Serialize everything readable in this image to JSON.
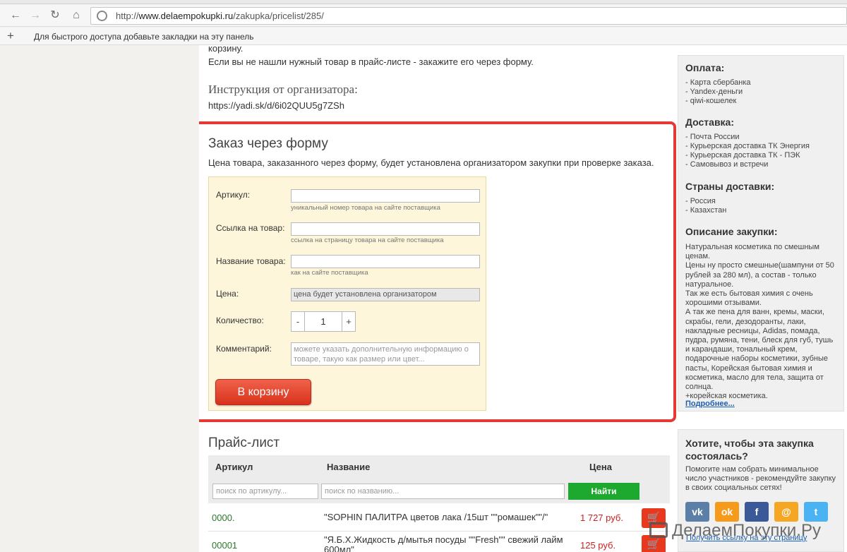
{
  "browser": {
    "url_host": "www.delaempokupki.ru",
    "url_path": "/zakupka/pricelist/285/",
    "url_prefix": "http://",
    "bookmarks_hint": "Для быстрого доступа добавьте закладки на эту панель"
  },
  "intro": {
    "cut_line": "корзину.",
    "not_found": "Если вы не нашли нужный товар в прайс-листе - закажите его через форму."
  },
  "instructions": {
    "title": "Инструкция от организатора:",
    "link": "https://yadi.sk/d/6i02QUU5g7ZSh"
  },
  "order_form": {
    "title": "Заказ через форму",
    "description": "Цена товара, заказанного через форму, будет установлена организатором закупки при проверке заказа.",
    "article_label": "Артикул:",
    "article_hint": "уникальный номер товара на сайте поставщика",
    "link_label": "Ссылка на товар:",
    "link_hint": "ссылка на страницу товара на сайте поставщика",
    "name_label": "Название товара:",
    "name_hint": "как на сайте поставщика",
    "price_label": "Цена:",
    "price_value": "цена будет установлена организатором",
    "qty_label": "Количество:",
    "qty_minus": "-",
    "qty_value": "1",
    "qty_plus": "+",
    "comment_label": "Комментарий:",
    "comment_placeholder": "можете указать дополнительную информацию о товаре, такую как размер или цвет...",
    "submit": "В корзину"
  },
  "pricelist": {
    "title": "Прайс-лист",
    "col_article": "Артикул",
    "col_name": "Название",
    "col_price": "Цена",
    "search_article_placeholder": "поиск по артикулу...",
    "search_name_placeholder": "поиск по названию...",
    "find_button": "Найти",
    "rows": [
      {
        "article": "0000.",
        "name": "\"SOPHIN ПАЛИТРА цветов лака /15шт \"\"ромашек\"\"/\"",
        "price": "1 727 руб."
      },
      {
        "article": "00001",
        "name": "\"Я.Б.Х.Жидкость д/мытья посуды \"\"Fresh\"\" свежий лайм 600мл\"",
        "price": "125 руб."
      }
    ]
  },
  "sidebar": {
    "payment_title": "Оплата:",
    "payment": [
      "- Карта сбербанка",
      "- Yandex-деньги",
      "- qiwi-кошелек"
    ],
    "delivery_title": "Доставка:",
    "delivery": [
      "- Почта России",
      "- Курьерская доставка ТК Энергия",
      "- Курьерская доставка ТК - ПЭК",
      "- Самовывоз и встречи"
    ],
    "countries_title": "Страны доставки:",
    "countries": [
      "- Россия",
      "- Казахстан"
    ],
    "description_title": "Описание закупки:",
    "description": "Натуральная косметика по смешным ценам.\nЦены ну просто смешные(шампуни от 50 рублей за 280 мл), а состав - только натуральное.\nТак же есть бытовая химия с очень хорошими отзывами.\nА так же пена для ванн, кремы, маски, скрабы, гели, дезодоранты, лаки, накладные ресницы, Adidas, помада, пудра, румяна, тени, блеск для губ, тушь и карандаши, тональный крем, подарочные наборы косметики, зубные пасты, Корейская бытовая химия и косметика, масло для тела, защита от солнца.\n+корейская косметика.",
    "more_link": "Подробнее..."
  },
  "share": {
    "title": "Хотите, чтобы эта закупка состоялась?",
    "text": "Помогите нам собрать минимальное число участников - рекомендуйте закупку в своих социальных сетях!",
    "link": "Получить ссылку на эту страницу",
    "networks": [
      {
        "name": "vk-icon",
        "glyph": "vk",
        "color": "#5b7fa6"
      },
      {
        "name": "odnoklassniki-icon",
        "glyph": "ok",
        "color": "#f59a1b"
      },
      {
        "name": "facebook-icon",
        "glyph": "f",
        "color": "#3b5998"
      },
      {
        "name": "mail-icon",
        "glyph": "@",
        "color": "#f5a623"
      },
      {
        "name": "twitter-icon",
        "glyph": "t",
        "color": "#4ab3f4"
      }
    ]
  },
  "watermark": "ДелаемПокупки.Ру"
}
